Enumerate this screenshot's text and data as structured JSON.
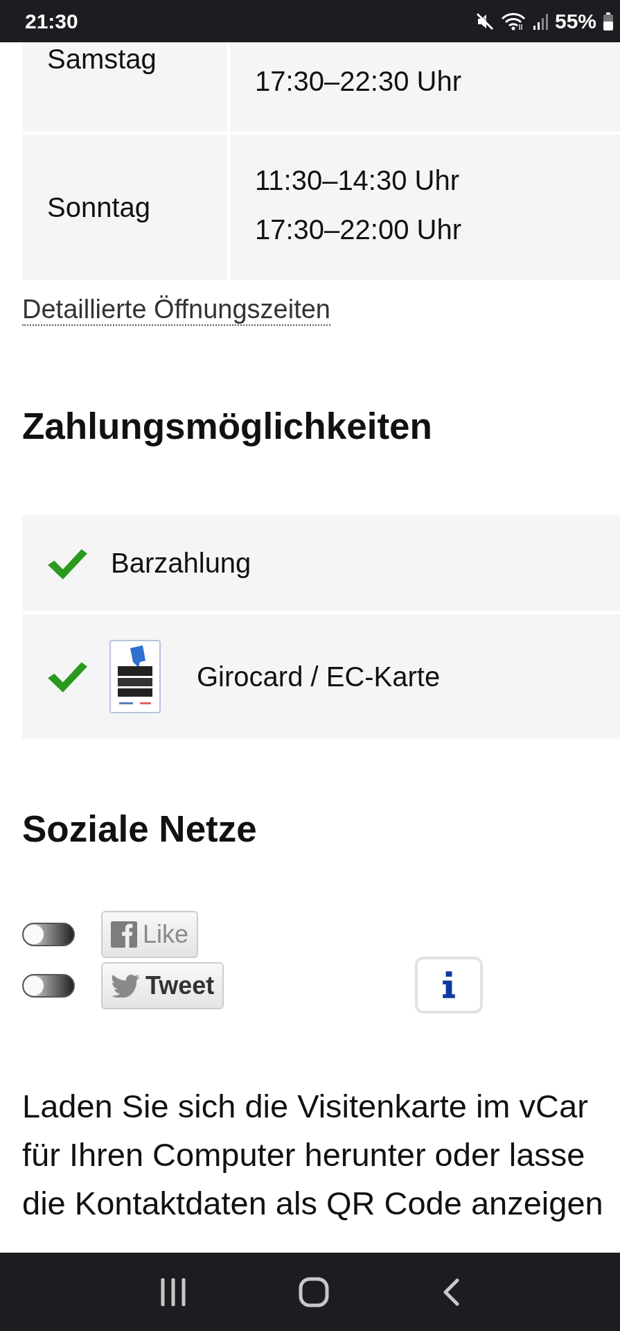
{
  "status_bar": {
    "time": "21:30",
    "battery": "55%"
  },
  "opening_hours": {
    "rows": [
      {
        "day": "Samstag",
        "times": [
          "17:30–22:30 Uhr"
        ]
      },
      {
        "day": "Sonntag",
        "times": [
          "11:30–14:30 Uhr",
          "17:30–22:00 Uhr"
        ]
      }
    ],
    "details_link": "Detaillierte Öffnungszeiten"
  },
  "payment": {
    "heading": "Zahlungsmöglichkeiten",
    "methods": [
      {
        "kind": "plain",
        "label": "Barzahlung",
        "checked": true
      },
      {
        "kind": "card",
        "label": "Girocard / EC-Karte",
        "checked": true
      }
    ]
  },
  "social": {
    "heading": "Soziale Netze",
    "buttons": [
      {
        "kind": "facebook",
        "label": "Like",
        "on": false
      },
      {
        "kind": "twitter",
        "label": "Tweet",
        "on": false
      }
    ]
  },
  "vcard_text": [
    "Laden Sie sich die Visitenkarte im vCar",
    "für Ihren Computer herunter oder lasse",
    "die Kontaktdaten als QR Code anzeigen"
  ]
}
